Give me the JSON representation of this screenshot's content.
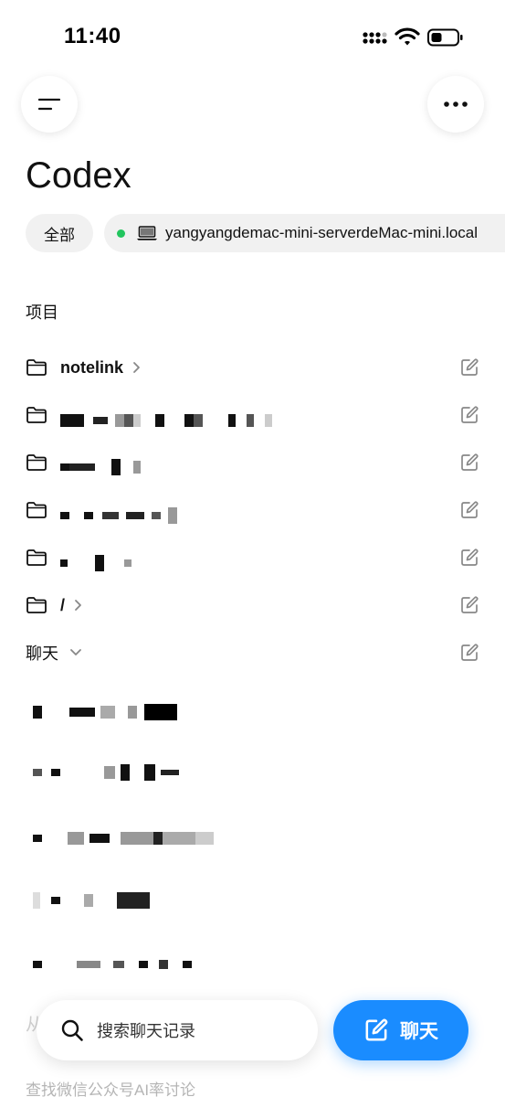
{
  "status_bar": {
    "time": "11:40"
  },
  "header": {
    "title": "Codex"
  },
  "filters": {
    "all_label": "全部",
    "host_label": "yangyangdemac-mini-serverdeMac-mini.local",
    "host_status_color": "#22c55e"
  },
  "projects": {
    "section_label": "项目",
    "items": [
      {
        "name": "notelink"
      },
      {
        "name": ""
      },
      {
        "name": ""
      },
      {
        "name": ""
      },
      {
        "name": ""
      },
      {
        "name": "/"
      }
    ]
  },
  "chats": {
    "section_label": "聊天"
  },
  "bottom": {
    "faded_prefix": "从",
    "search_placeholder": "搜索聊天记录",
    "chat_button_label": "聊天",
    "footer_text": "查找微信公众号AI率讨论"
  },
  "colors": {
    "accent": "#1a8cff",
    "status_online": "#22c55e"
  }
}
